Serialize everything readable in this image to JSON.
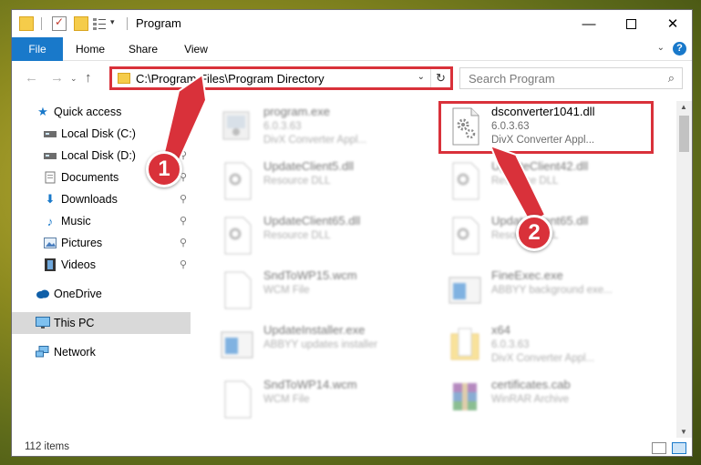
{
  "window": {
    "title": "Program",
    "controls": {
      "minimize": "—",
      "maximize": "",
      "close": "✕"
    }
  },
  "ribbon": {
    "tabs": [
      "File",
      "Home",
      "Share",
      "View"
    ],
    "help": "?"
  },
  "nav": {
    "address": "C:\\Program Files\\Program Directory",
    "search_placeholder": "Search Program"
  },
  "sidebar": {
    "items": [
      {
        "label": "Quick access",
        "icon": "star-icon",
        "pinned": false
      },
      {
        "label": "Local Disk (C:)",
        "icon": "drive-icon",
        "pinned": false
      },
      {
        "label": "Local Disk (D:)",
        "icon": "drive-icon",
        "pinned": false
      },
      {
        "label": "Documents",
        "icon": "documents-icon",
        "pinned": true
      },
      {
        "label": "Downloads",
        "icon": "download-arrow-icon",
        "pinned": true
      },
      {
        "label": "Music",
        "icon": "music-note-icon",
        "pinned": true
      },
      {
        "label": "Pictures",
        "icon": "pictures-icon",
        "pinned": true
      },
      {
        "label": "Videos",
        "icon": "film-icon",
        "pinned": true
      },
      {
        "label": "OneDrive",
        "icon": "cloud-icon",
        "pinned": false
      },
      {
        "label": "This PC",
        "icon": "monitor-icon",
        "pinned": false,
        "selected": true
      },
      {
        "label": "Network",
        "icon": "network-icon",
        "pinned": false
      }
    ]
  },
  "files": [
    {
      "name": "program.exe",
      "line1": "6.0.3.63",
      "line2": "DivX Converter Appl...",
      "icon": "exe-icon",
      "faded": true
    },
    {
      "name": "dsconverter1041.dll",
      "line1": "6.0.3.63",
      "line2": "DivX Converter Appl...",
      "icon": "dll-gear-icon",
      "faded": false,
      "highlighted": true
    },
    {
      "name": "UpdateClient5.dll",
      "line1": "Resource DLL",
      "line2": "",
      "icon": "dll-gear-icon",
      "faded": true
    },
    {
      "name": "UpdateClient42.dll",
      "line1": "Resource DLL",
      "line2": "",
      "icon": "dll-gear-icon",
      "faded": true
    },
    {
      "name": "UpdateClient65.dll",
      "line1": "Resource DLL",
      "line2": "",
      "icon": "dll-gear-icon",
      "faded": true
    },
    {
      "name": "UpdateClient65.dll",
      "line1": "Resource DLL",
      "line2": "",
      "icon": "dll-gear-icon",
      "faded": true
    },
    {
      "name": "SndToWP15.wcm",
      "line1": "WCM File",
      "line2": "",
      "icon": "blank-file-icon",
      "faded": true
    },
    {
      "name": "FineExec.exe",
      "line1": "ABBYY background exe...",
      "line2": "",
      "icon": "exe-window-icon",
      "faded": true
    },
    {
      "name": "UpdateInstaller.exe",
      "line1": "ABBYY updates installer",
      "line2": "",
      "icon": "exe-window-icon",
      "faded": true
    },
    {
      "name": "x64",
      "line1": "6.0.3.63",
      "line2": "DivX Converter Appl...",
      "icon": "folder-icon",
      "faded": true
    },
    {
      "name": "SndToWP14.wcm",
      "line1": "WCM File",
      "line2": "",
      "icon": "blank-file-icon",
      "faded": true
    },
    {
      "name": "certificates.cab",
      "line1": "WinRAR Archive",
      "line2": "",
      "icon": "winrar-icon",
      "faded": true
    }
  ],
  "status": {
    "items": "112 items"
  },
  "callouts": {
    "one": "1",
    "two": "2"
  },
  "colors": {
    "accent": "#1979ca",
    "highlight": "#d9313a",
    "selected": "#d9d9d9"
  }
}
